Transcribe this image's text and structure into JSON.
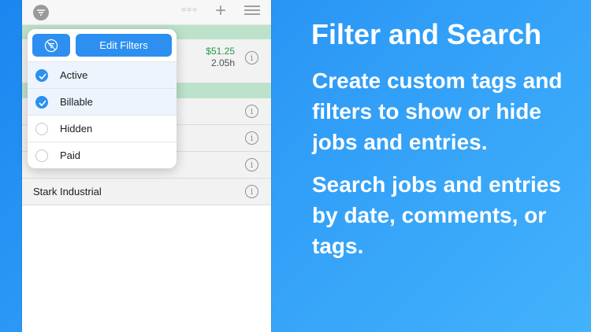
{
  "popover": {
    "edit_filters_label": "Edit Filters",
    "filters": [
      {
        "label": "Active",
        "checked": true
      },
      {
        "label": "Billable",
        "checked": true
      },
      {
        "label": "Hidden",
        "checked": false
      },
      {
        "label": "Paid",
        "checked": false
      }
    ]
  },
  "entry": {
    "amount": "$51.25",
    "hours": "2.05h"
  },
  "jobs": [
    {
      "label": ""
    },
    {
      "label": ""
    },
    {
      "label": ""
    },
    {
      "label": "Stark Industrial"
    }
  ],
  "marketing": {
    "headline": "Filter and Search",
    "paragraph1": "Create custom tags and filters to show or hide jobs and entries.",
    "paragraph2": "Search jobs and entries by date, comments, or tags."
  },
  "colors": {
    "accent": "#2d8ff0",
    "amount": "#2aa150",
    "band": "#c8efd6",
    "background": "#2f9cf7"
  }
}
